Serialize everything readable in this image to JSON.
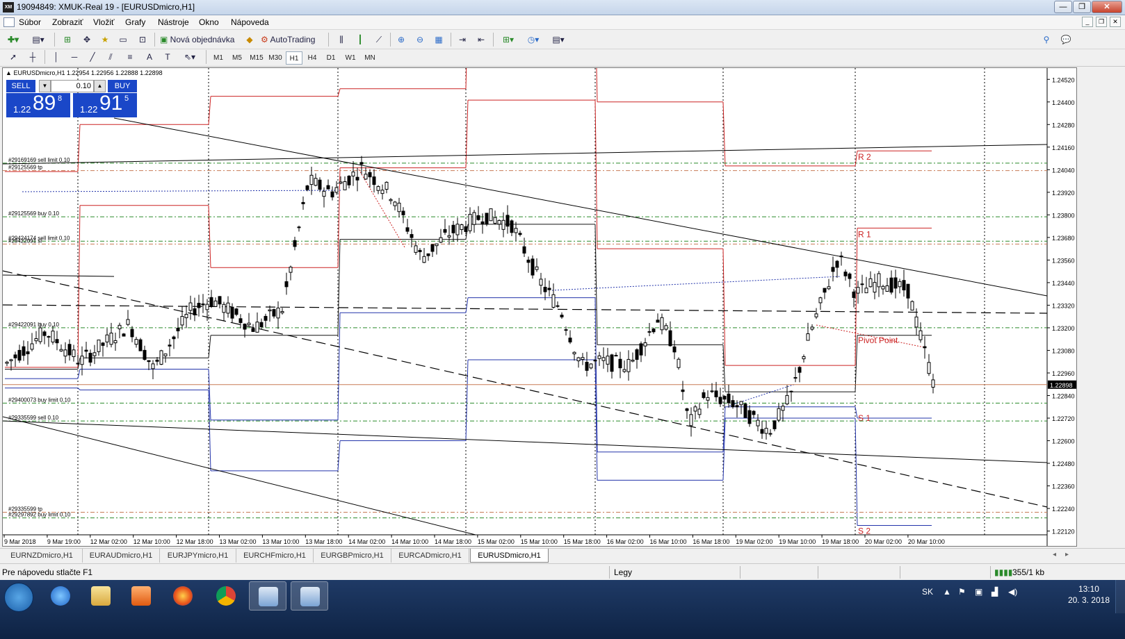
{
  "window": {
    "title": "19094849: XMUK-Real 19 - [EURUSDmicro,H1]",
    "app_icon": "XM"
  },
  "menu": {
    "items": [
      "Súbor",
      "Zobraziť",
      "Vložiť",
      "Grafy",
      "Nástroje",
      "Okno",
      "Nápoveda"
    ]
  },
  "toolbar": {
    "new_order": "Nová objednávka",
    "autotrading": "AutoTrading"
  },
  "timeframes": [
    "M1",
    "M5",
    "M15",
    "M30",
    "H1",
    "H4",
    "D1",
    "W1",
    "MN"
  ],
  "active_timeframe": "H1",
  "chart": {
    "header": "EURUSDmicro,H1",
    "ohlc": "1.22954 1.22956 1.22888 1.22898",
    "current_price": "1.22898",
    "trade": {
      "sell_label": "SELL",
      "buy_label": "BUY",
      "lot": "0.10",
      "bid_prefix": "1.22",
      "bid_big": "89",
      "bid_sup": "8",
      "ask_prefix": "1.22",
      "ask_big": "91",
      "ask_sup": "5"
    },
    "price_axis": [
      "1.24520",
      "1.24400",
      "1.24280",
      "1.24160",
      "1.24040",
      "1.23920",
      "1.23800",
      "1.23680",
      "1.23560",
      "1.23440",
      "1.23320",
      "1.23200",
      "1.23080",
      "1.22960",
      "1.22840",
      "1.22720",
      "1.22600",
      "1.22480",
      "1.22360",
      "1.22240",
      "1.22120"
    ],
    "time_axis": [
      "9 Mar 2018",
      "9 Mar 19:00",
      "12 Mar 02:00",
      "12 Mar 10:00",
      "12 Mar 18:00",
      "13 Mar 02:00",
      "13 Mar 10:00",
      "13 Mar 18:00",
      "14 Mar 02:00",
      "14 Mar 10:00",
      "14 Mar 18:00",
      "15 Mar 02:00",
      "15 Mar 10:00",
      "15 Mar 18:00",
      "16 Mar 02:00",
      "16 Mar 10:00",
      "16 Mar 18:00",
      "19 Mar 02:00",
      "19 Mar 10:00",
      "19 Mar 18:00",
      "20 Mar 02:00",
      "20 Mar 10:00"
    ],
    "order_labels": [
      "#29169169 sell limit 0.10",
      "#29125569 tp",
      "#29125569 buy 0.10",
      "#29424174 sell limit 0.10",
      "#29422091 sl",
      "#29422091 buy 0.10",
      "#29400073 buy limit 0.10",
      "#29335599 sell 0.10",
      "#29335599 tp",
      "#29297892 buy limit 0.10"
    ],
    "pivot_labels": [
      "R 2",
      "R 1",
      "Pivot Point",
      "S 1",
      "S 2"
    ],
    "colors": {
      "resistance": "#cc2222",
      "support": "#2233aa",
      "pivot": "#111111",
      "order_line": "#2a8a2a",
      "price_line": "#c77a55"
    }
  },
  "tabs": [
    "EURNZDmicro,H1",
    "EURAUDmicro,H1",
    "EURJPYmicro,H1",
    "EURCHFmicro,H1",
    "EURGBPmicro,H1",
    "EURCADmicro,H1",
    "EURUSDmicro,H1"
  ],
  "active_tab": "EURUSDmicro,H1",
  "status": {
    "help": "Pre nápovedu stlačte F1",
    "profile": "Legy",
    "connection": "355/1 kb"
  },
  "taskbar": {
    "lang": "SK",
    "time": "13:10",
    "date": "20. 3. 2018",
    "apps": [
      "internet-explorer",
      "file-explorer",
      "media-player",
      "firefox",
      "chrome",
      "metatrader",
      "metatrader-2"
    ]
  }
}
